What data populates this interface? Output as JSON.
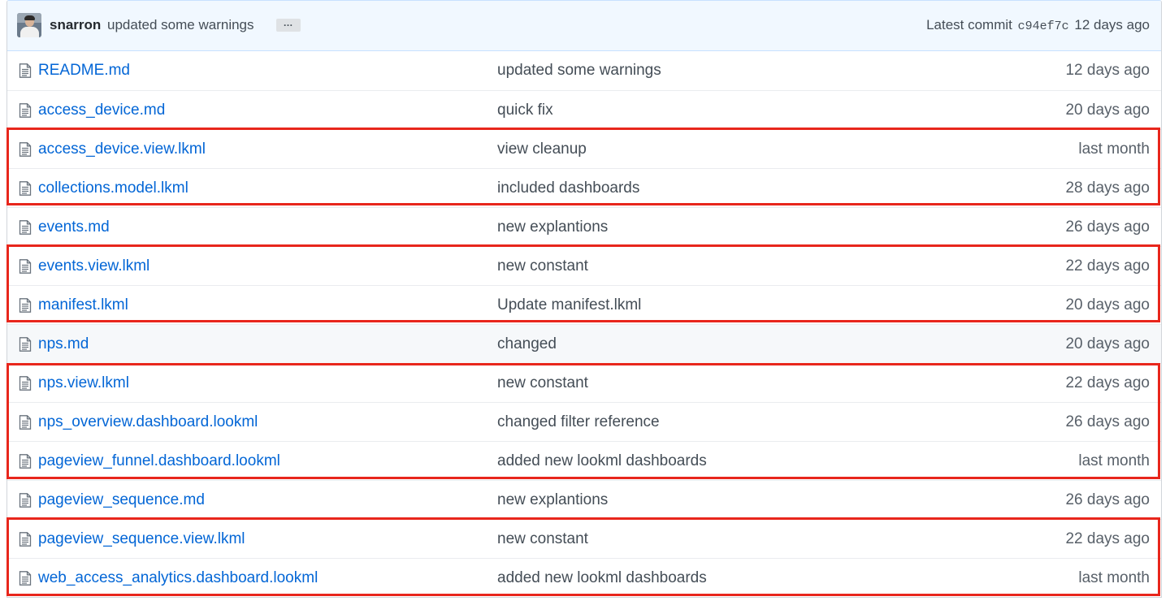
{
  "commit": {
    "author": "snarron",
    "message": "updated some warnings",
    "ellipsis": "…",
    "latest_label": "Latest commit",
    "sha": "c94ef7c",
    "age": "12 days ago"
  },
  "files": [
    {
      "name": "README.md",
      "message": "updated some warnings",
      "age": "12 days ago"
    },
    {
      "name": "access_device.md",
      "message": "quick fix",
      "age": "20 days ago"
    },
    {
      "name": "access_device.view.lkml",
      "message": "view cleanup",
      "age": "last month"
    },
    {
      "name": "collections.model.lkml",
      "message": "included dashboards",
      "age": "28 days ago"
    },
    {
      "name": "events.md",
      "message": "new explantions",
      "age": "26 days ago"
    },
    {
      "name": "events.view.lkml",
      "message": "new constant",
      "age": "22 days ago"
    },
    {
      "name": "manifest.lkml",
      "message": "Update manifest.lkml",
      "age": "20 days ago"
    },
    {
      "name": "nps.md",
      "message": "changed",
      "age": "20 days ago"
    },
    {
      "name": "nps.view.lkml",
      "message": "new constant",
      "age": "22 days ago"
    },
    {
      "name": "nps_overview.dashboard.lookml",
      "message": "changed filter reference",
      "age": "26 days ago"
    },
    {
      "name": "pageview_funnel.dashboard.lookml",
      "message": "added new lookml dashboards",
      "age": "last month"
    },
    {
      "name": "pageview_sequence.md",
      "message": "new explantions",
      "age": "26 days ago"
    },
    {
      "name": "pageview_sequence.view.lkml",
      "message": "new constant",
      "age": "22 days ago"
    },
    {
      "name": "web_access_analytics.dashboard.lookml",
      "message": "added new lookml dashboards",
      "age": "last month"
    }
  ],
  "icons": {
    "file": "file-text-icon",
    "avatar": "user-avatar"
  },
  "colors": {
    "link": "#0366d6",
    "highlight_border": "#e8261c",
    "commit_bar_bg": "#f1f8ff"
  }
}
